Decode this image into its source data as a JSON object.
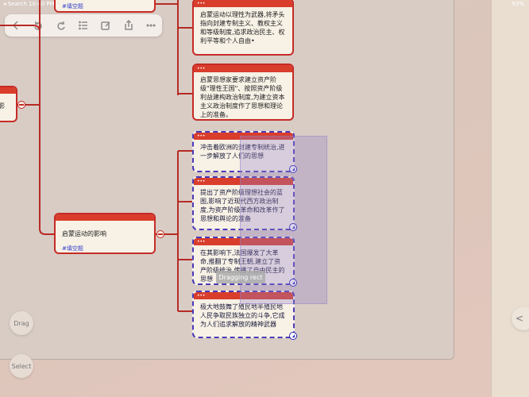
{
  "status_bar": {
    "left": "◂ Search   10:40 PM",
    "right": "93%"
  },
  "toolbar": {
    "buttons": [
      "back-icon",
      "undo-icon",
      "redo-icon",
      "list-icon",
      "edit-icon",
      "share-icon",
      "more-icon"
    ]
  },
  "mindmap": {
    "top_partial_fill": "#填空题",
    "left_partial_topic": "影",
    "topic": {
      "title": "启蒙运动的影响",
      "fill": "#填空题"
    },
    "upper_nodes": [
      "启蒙运动以理性为武器,将矛头指向封建专制主义、教权主义和等级制度,追求政治民主、权利平等和个人自由•",
      "启蒙思想家要求建立资产阶级\"理性王国\"、按照资产阶级利益建构政治制度,为建立资本主义政治制度作了思想和理论上的准备。"
    ],
    "selected_nodes": [
      "冲击着欧洲的封建专制统治,进一步解放了人们的思想",
      "提出了资产阶级理想社会的蓝图,影响了近现代西方政治制度,为资产阶级革命和改革作了思想和舆论的准备",
      "在其影响下,法国爆发了大革命,推翻了专制王朝,建立了资产阶级统治,传播了自由民主的思想",
      "极大地鼓舞了殖民地半殖民地人民争取民族独立的斗争,它成为人们追求解放的精神武器"
    ]
  },
  "drag_label": "Dragging rect",
  "buttons": {
    "drag": "Drag",
    "select": "Select",
    "side": "<"
  },
  "colors": {
    "accent": "#c62b26",
    "header": "#d93d2c",
    "selection": "#4a3ab8",
    "fill_link": "#3340c8"
  }
}
